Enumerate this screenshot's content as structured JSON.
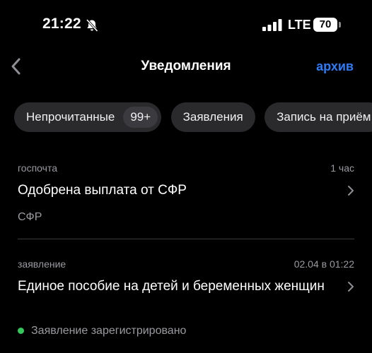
{
  "status_bar": {
    "time": "21:22",
    "network": "LTE",
    "battery": "70",
    "icons": [
      "mute-bell-icon",
      "signal-icon",
      "battery-icon"
    ]
  },
  "nav": {
    "title": "Уведомления",
    "archive_label": "архив",
    "back_icon": "chevron-left-icon",
    "accent_color": "#2f7bf6"
  },
  "chips": [
    {
      "label": "Непрочитанные",
      "badge": "99+"
    },
    {
      "label": "Заявления"
    },
    {
      "label": "Запись на приём"
    }
  ],
  "notifications": [
    {
      "category": "госпочта",
      "time": "1 час",
      "title": "Одобрена выплата от СФР",
      "subtitle": "СФР"
    },
    {
      "category": "заявление",
      "time": "02.04 в 01:22",
      "title": "Единое пособие на детей и беременных женщин",
      "status": "Заявление зарегистрировано",
      "status_color": "#34c759"
    }
  ]
}
